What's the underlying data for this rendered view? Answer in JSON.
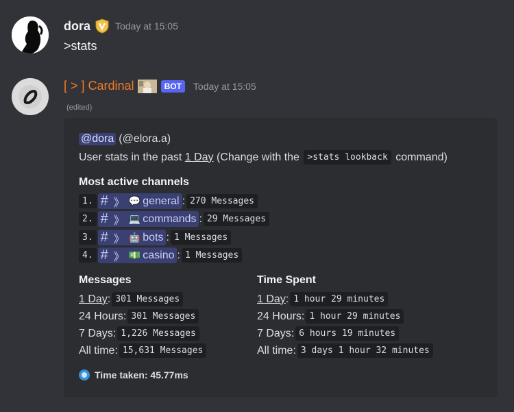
{
  "message_user": {
    "username": "dora",
    "timestamp": "Today at 15:05",
    "content": ">stats"
  },
  "message_bot": {
    "username": "[ > ] Cardinal",
    "bot_badge": "BOT",
    "timestamp": "Today at 15:05",
    "edited": "(edited)"
  },
  "embed": {
    "mention": "@dora",
    "handle": "(@elora.a)",
    "intro_prefix": "User stats in the past ",
    "intro_period": "1 Day",
    "intro_mid": " (Change with the ",
    "intro_code": ">stats lookback",
    "intro_suffix": " command)",
    "channels_title": "Most active channels",
    "channels": [
      {
        "num": "1.",
        "emoji": "💬",
        "name": "general",
        "count": "270 Messages"
      },
      {
        "num": "2.",
        "emoji": "💻",
        "name": "commands",
        "count": "29 Messages"
      },
      {
        "num": "3.",
        "emoji": "🤖",
        "name": "bots",
        "count": "1 Messages"
      },
      {
        "num": "4.",
        "emoji": "💵",
        "name": "casino",
        "count": "1 Messages"
      }
    ],
    "messages_title": "Messages",
    "messages": [
      {
        "label": "1 Day",
        "value": "301 Messages"
      },
      {
        "label": "24 Hours",
        "value": "301 Messages"
      },
      {
        "label": "7 Days",
        "value": "1,226 Messages"
      },
      {
        "label": "All time",
        "value": "15,631 Messages"
      }
    ],
    "time_title": "Time Spent",
    "time": [
      {
        "label": "1 Day",
        "value": "1 hour 29 minutes"
      },
      {
        "label": "24 Hours",
        "value": "1 hour 29 minutes"
      },
      {
        "label": "7 Days",
        "value": "6 hours 19 minutes"
      },
      {
        "label": "All time",
        "value": "3 days 1 hour 32 minutes"
      }
    ],
    "time_taken": "Time taken: 45.77ms"
  },
  "colors": {
    "background": "#313338",
    "embed_bg": "#2b2d31",
    "bot_name": "#f47b25",
    "badge": "#5865f2"
  }
}
